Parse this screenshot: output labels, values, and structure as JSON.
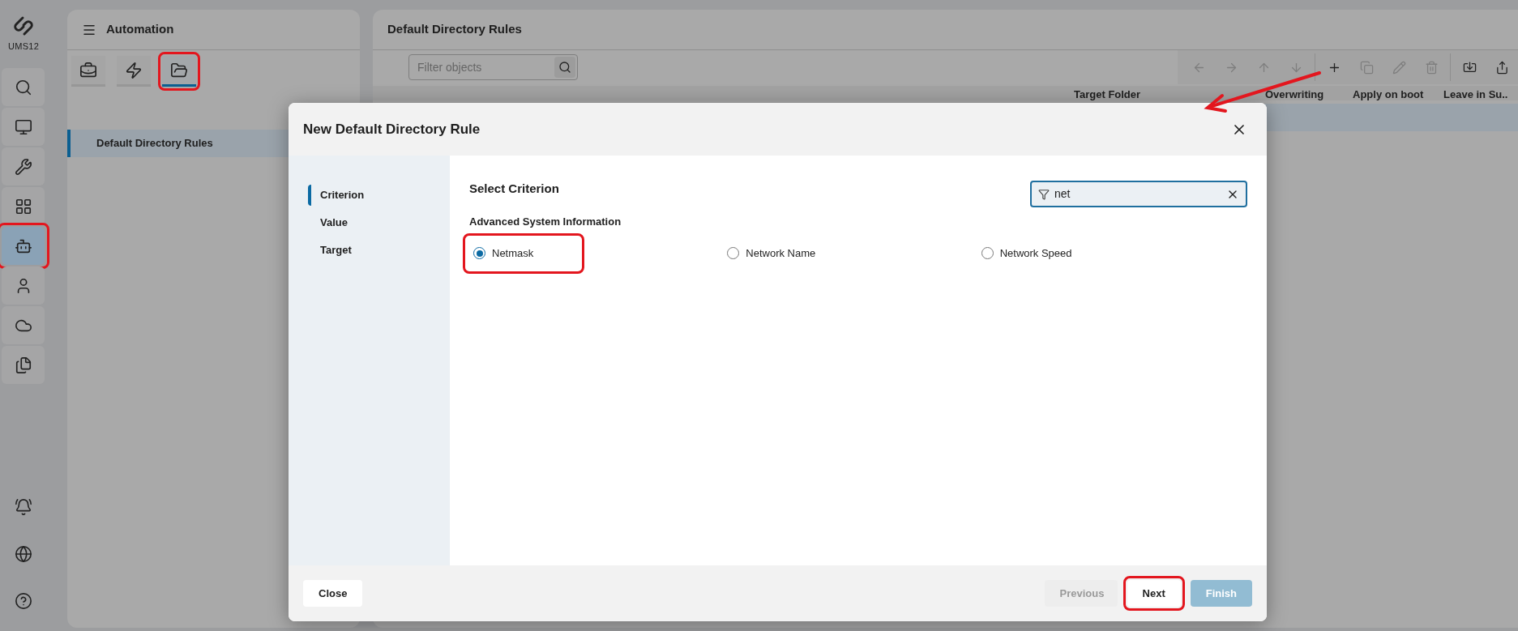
{
  "rail": {
    "logo": "UMS12",
    "items": [
      {
        "kind": "search",
        "selected": false,
        "highlighted": false
      },
      {
        "kind": "monitor",
        "selected": false,
        "highlighted": false
      },
      {
        "kind": "tools",
        "selected": false,
        "highlighted": false
      },
      {
        "kind": "apps",
        "selected": false,
        "highlighted": false
      },
      {
        "kind": "robot",
        "selected": true,
        "highlighted": true
      },
      {
        "kind": "user",
        "selected": false,
        "highlighted": false
      },
      {
        "kind": "cloud",
        "selected": false,
        "highlighted": false
      },
      {
        "kind": "document",
        "selected": false,
        "highlighted": false
      }
    ],
    "bottom": [
      {
        "kind": "bell"
      },
      {
        "kind": "globe"
      },
      {
        "kind": "help"
      }
    ]
  },
  "automation_panel": {
    "title": "Automation",
    "tabs": [
      {
        "kind": "briefcase",
        "selected": false,
        "highlighted": false
      },
      {
        "kind": "bolt",
        "selected": false,
        "highlighted": false
      },
      {
        "kind": "folder",
        "selected": true,
        "highlighted": true
      }
    ],
    "items": [
      {
        "label": "Default Directory Rules",
        "selected": true
      }
    ]
  },
  "main_panel": {
    "title": "Default Directory Rules",
    "filter": {
      "placeholder": "Filter objects"
    },
    "toolbar": [
      {
        "kind": "arrow-left",
        "disabled": true
      },
      {
        "kind": "arrow-right",
        "disabled": true
      },
      {
        "kind": "arrow-up",
        "disabled": true
      },
      {
        "kind": "arrow-down",
        "disabled": true
      },
      {
        "kind": "separator"
      },
      {
        "kind": "add",
        "disabled": false
      },
      {
        "kind": "copy",
        "disabled": true
      },
      {
        "kind": "edit",
        "disabled": true
      },
      {
        "kind": "delete",
        "disabled": true
      },
      {
        "kind": "separator"
      },
      {
        "kind": "import",
        "disabled": false
      },
      {
        "kind": "export",
        "disabled": false
      }
    ],
    "columns": [
      "Target Folder",
      "Overwriting",
      "Apply on boot",
      "Leave in Su.."
    ]
  },
  "dialog": {
    "title": "New Default Directory Rule",
    "steps": [
      {
        "label": "Criterion",
        "selected": true
      },
      {
        "label": "Value",
        "selected": false
      },
      {
        "label": "Target",
        "selected": false
      }
    ],
    "heading": "Select Criterion",
    "search": {
      "value": "net"
    },
    "group": "Advanced System Information",
    "options": [
      {
        "label": "Netmask",
        "selected": true,
        "highlighted": true
      },
      {
        "label": "Network Name",
        "selected": false,
        "highlighted": false
      },
      {
        "label": "Network Speed",
        "selected": false,
        "highlighted": false
      }
    ],
    "buttons": [
      {
        "label": "Close",
        "kind": "secondary",
        "disabled": false,
        "highlighted": false
      },
      {
        "label": "Previous",
        "kind": "secondary",
        "disabled": true,
        "highlighted": false
      },
      {
        "label": "Next",
        "kind": "secondary",
        "disabled": false,
        "highlighted": true
      },
      {
        "label": "Finish",
        "kind": "primary",
        "disabled": true,
        "highlighted": false
      }
    ]
  },
  "annotation_arrow": true
}
